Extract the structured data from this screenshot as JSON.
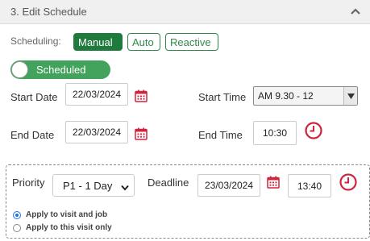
{
  "section": {
    "title": "3. Edit Schedule",
    "collapse_icon": "chevron-up-icon"
  },
  "scheduling": {
    "label": "Scheduling:",
    "options": [
      "Manual",
      "Auto",
      "Reactive"
    ],
    "selected": "Manual"
  },
  "toggle": {
    "label": "Scheduled",
    "on": true
  },
  "start_date": {
    "label": "Start Date",
    "value": "22/03/2024",
    "icon": "calendar-icon"
  },
  "start_time": {
    "label": "Start Time",
    "value": "AM 9.30 - 12",
    "icon": "dropdown-arrow-icon"
  },
  "end_date": {
    "label": "End Date",
    "value": "22/03/2024",
    "icon": "calendar-icon"
  },
  "end_time": {
    "label": "End Time",
    "value": "10:30",
    "icon": "clock-icon"
  },
  "priority": {
    "label": "Priority",
    "value": "P1 - 1 Day"
  },
  "deadline": {
    "label": "Deadline",
    "date": "23/03/2024",
    "time": "13:40"
  },
  "apply_options": [
    {
      "label": "Apply to visit and job",
      "checked": true
    },
    {
      "label": "Apply to this visit only",
      "checked": false
    }
  ],
  "colors": {
    "manual_bg": "#1f7a3e",
    "toggle_bg": "#43a35c",
    "outline_green": "#2f8a4a",
    "icon_red": "#d0243d",
    "radio_blue": "#1a73e8"
  }
}
